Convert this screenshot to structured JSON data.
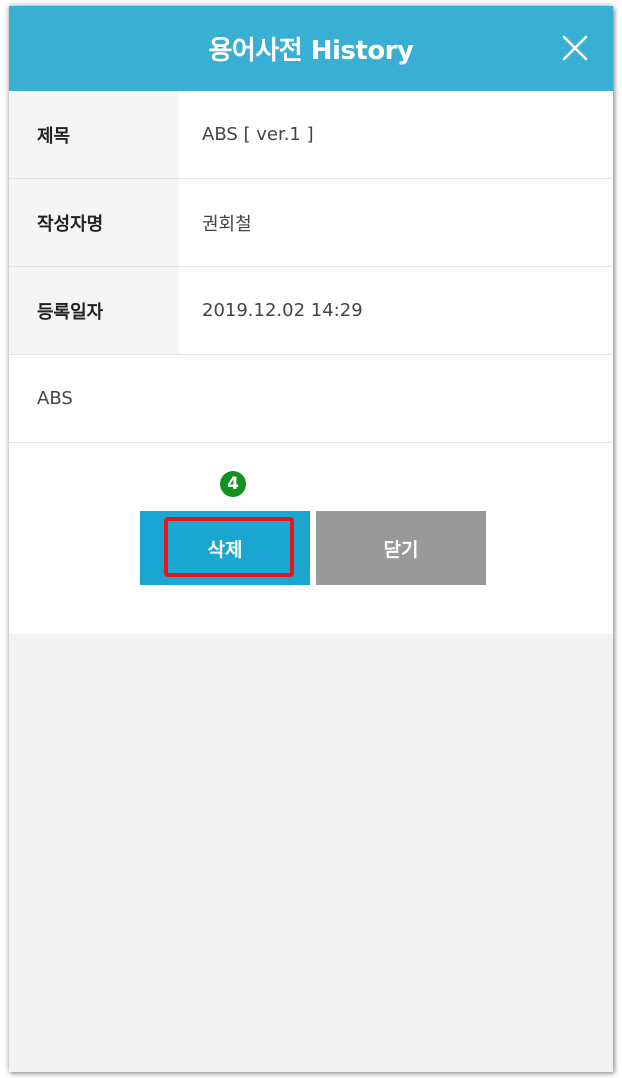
{
  "header": {
    "title": "용어사전 History",
    "close_icon": "close-icon",
    "color": "#39b0d3"
  },
  "fields": [
    {
      "label": "제목",
      "value": "ABS [ ver.1 ]"
    },
    {
      "label": "작성자명",
      "value": "권회철"
    },
    {
      "label": "등록일자",
      "value": "2019.12.02 14:29"
    }
  ],
  "body_text": "ABS",
  "step_badge": "4",
  "buttons": {
    "delete_label": "삭제",
    "close_label": "닫기",
    "delete_color": "#1aa6d0",
    "close_color": "#999999"
  },
  "highlight_color": "#e3161b"
}
